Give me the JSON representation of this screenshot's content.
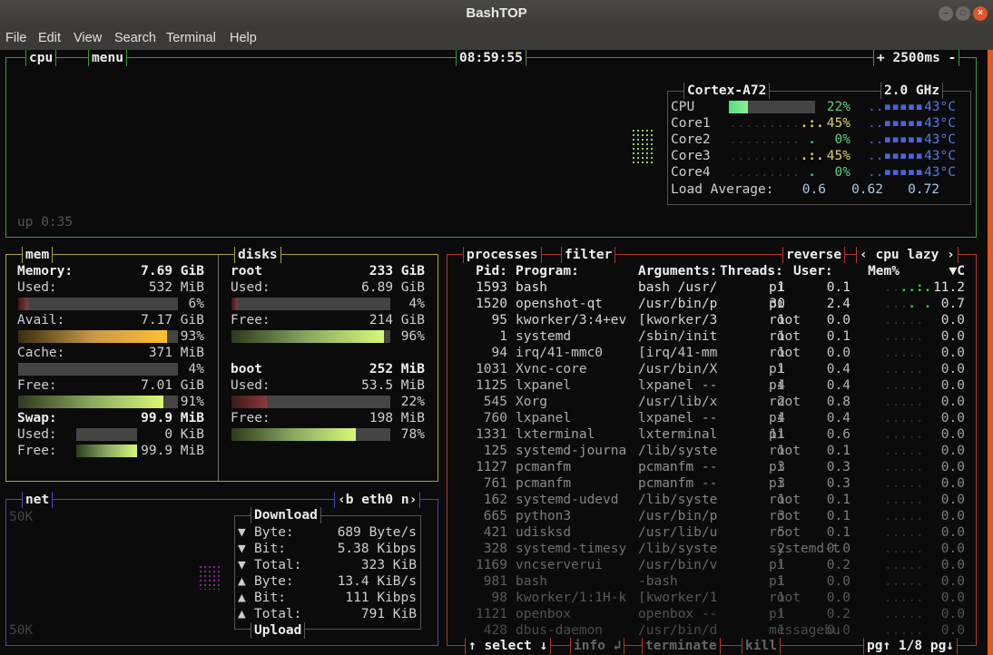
{
  "window": {
    "title": "BashTOP",
    "menu": [
      "File",
      "Edit",
      "View",
      "Search",
      "Terminal",
      "Help"
    ]
  },
  "colors": {
    "cpu_border": "#3a9a3a",
    "mem_border": "#a8a23a",
    "net_border": "#4a44c8",
    "proc_border": "#b03434",
    "scrollbar": "#e05a20"
  },
  "cpu": {
    "title": "cpu",
    "menu": "menu",
    "clock": "08:59:55",
    "interval": "+ 2500ms -",
    "uptime": "up 0:35",
    "model": "Cortex-A72",
    "freq": "2.0 GHz",
    "rows": [
      {
        "label": "CPU",
        "pct": "22%",
        "temp": "43°C",
        "value": 22
      },
      {
        "label": "Core1",
        "pct": "45%",
        "temp": "43°C",
        "value": 45
      },
      {
        "label": "Core2",
        "pct": "0%",
        "temp": "43°C",
        "value": 0
      },
      {
        "label": "Core3",
        "pct": "45%",
        "temp": "43°C",
        "value": 45
      },
      {
        "label": "Core4",
        "pct": "0%",
        "temp": "43°C",
        "value": 0
      }
    ],
    "load_label": "Load Average:",
    "load": [
      "0.6",
      "0.62",
      "0.72"
    ]
  },
  "mem": {
    "title": "mem",
    "memory_label": "Memory:",
    "memory_total": "7.69 GiB",
    "items": [
      {
        "label": "Used:",
        "value": "532 MiB",
        "pct": "6%",
        "level": 6
      },
      {
        "label": "Avail:",
        "value": "7.17 GiB",
        "pct": "93%",
        "level": 93
      },
      {
        "label": "Cache:",
        "value": "371 MiB",
        "pct": "4%",
        "level": 4
      },
      {
        "label": "Free:",
        "value": "7.01 GiB",
        "pct": "91%",
        "level": 91
      }
    ],
    "swap_label": "Swap:",
    "swap_total": "99.9 MiB",
    "swap_used_label": "Used:",
    "swap_used": "0 KiB",
    "swap_used_level": 0,
    "swap_free_label": "Free:",
    "swap_free": "99.9 MiB",
    "swap_free_level": 100
  },
  "disks": {
    "title": "disks",
    "list": [
      {
        "name": "root",
        "total": "233 GiB",
        "used_label": "Used:",
        "used": "6.89 GiB",
        "used_pct": "4%",
        "used_level": 4,
        "free_label": "Free:",
        "free": "214 GiB",
        "free_pct": "96%",
        "free_level": 96
      },
      {
        "name": "boot",
        "total": "252 MiB",
        "used_label": "Used:",
        "used": "53.5 MiB",
        "used_pct": "22%",
        "used_level": 22,
        "free_label": "Free:",
        "free": "198 MiB",
        "free_pct": "78%",
        "free_level": 78
      }
    ]
  },
  "net": {
    "title": "net",
    "iface": "‹b eth0 n›",
    "scale_top": "50K",
    "scale_bottom": "50K",
    "download_title": "Download",
    "upload_title": "Upload",
    "rows": [
      {
        "dir": "▼",
        "label": "Byte:",
        "value": "689 Byte/s"
      },
      {
        "dir": "▼",
        "label": "Bit:",
        "value": "5.38 Kibps"
      },
      {
        "dir": "▼",
        "label": "Total:",
        "value": "323 KiB"
      },
      {
        "dir": "▲",
        "label": "Byte:",
        "value": "13.4 KiB/s"
      },
      {
        "dir": "▲",
        "label": "Bit:",
        "value": "111 Kibps"
      },
      {
        "dir": "▲",
        "label": "Total:",
        "value": "791 KiB"
      }
    ]
  },
  "proc": {
    "title": "processes",
    "filter": "filter",
    "reverse": "reverse",
    "sort": "‹ cpu lazy ›",
    "headers": {
      "pid": "Pid:",
      "program": "Program:",
      "args": "Arguments:",
      "threads": "Threads:",
      "user": "User:",
      "mem": "Mem%",
      "cpu": "▼C"
    },
    "rows": [
      [
        "1593",
        "bash",
        "bash /usr/",
        "1",
        "pi",
        "0.1",
        "11.2"
      ],
      [
        "1520",
        "openshot-qt",
        "/usr/bin/p",
        "30",
        "pi",
        "2.4",
        "0.7"
      ],
      [
        "95",
        "kworker/3:4+ev",
        "[kworker/3",
        "1",
        "root",
        "0.0",
        "0.0"
      ],
      [
        "1",
        "systemd",
        "/sbin/init",
        "1",
        "root",
        "0.1",
        "0.0"
      ],
      [
        "94",
        "irq/41-mmc0",
        "[irq/41-mm",
        "1",
        "root",
        "0.0",
        "0.0"
      ],
      [
        "1031",
        "Xvnc-core",
        "/usr/bin/X",
        "1",
        "pi",
        "0.4",
        "0.0"
      ],
      [
        "1125",
        "lxpanel",
        "lxpanel --",
        "4",
        "pi",
        "0.4",
        "0.0"
      ],
      [
        "545",
        "Xorg",
        "/usr/lib/x",
        "2",
        "root",
        "0.8",
        "0.0"
      ],
      [
        "760",
        "lxpanel",
        "lxpanel --",
        "4",
        "pi",
        "0.4",
        "0.0"
      ],
      [
        "1331",
        "lxterminal",
        "lxterminal",
        "11",
        "pi",
        "0.6",
        "0.0"
      ],
      [
        "125",
        "systemd-journa",
        "/lib/syste",
        "1",
        "root",
        "0.1",
        "0.0"
      ],
      [
        "1127",
        "pcmanfm",
        "pcmanfm --",
        "3",
        "pi",
        "0.3",
        "0.0"
      ],
      [
        "761",
        "pcmanfm",
        "pcmanfm --",
        "3",
        "pi",
        "0.3",
        "0.0"
      ],
      [
        "162",
        "systemd-udevd",
        "/lib/syste",
        "1",
        "root",
        "0.1",
        "0.0"
      ],
      [
        "665",
        "python3",
        "/usr/bin/p",
        "3",
        "root",
        "0.1",
        "0.0"
      ],
      [
        "421",
        "udisksd",
        "/usr/lib/u",
        "5",
        "root",
        "0.1",
        "0.0"
      ],
      [
        "328",
        "systemd-timesy",
        "/lib/syste",
        "2",
        "systemd-t",
        "0.0",
        "0.0"
      ],
      [
        "1169",
        "vncserverui",
        "/usr/bin/v",
        "1",
        "pi",
        "0.2",
        "0.0"
      ],
      [
        "981",
        "bash",
        "-bash",
        "1",
        "pi",
        "0.0",
        "0.0"
      ],
      [
        "98",
        "kworker/1:1H-k",
        "[kworker/1",
        "1",
        "root",
        "0.0",
        "0.0"
      ],
      [
        "1121",
        "openbox",
        "openbox --",
        "1",
        "pi",
        "0.2",
        "0.0"
      ],
      [
        "428",
        "dbus-daemon",
        "/usr/bin/d",
        "1",
        "messagebu",
        "0.0",
        "0.0"
      ]
    ],
    "footer": {
      "select": "↑ select ↓",
      "info": "info ↲",
      "terminate": "terminate",
      "kill": "kill",
      "page": "pg↑ 1/8 pg↓"
    }
  }
}
